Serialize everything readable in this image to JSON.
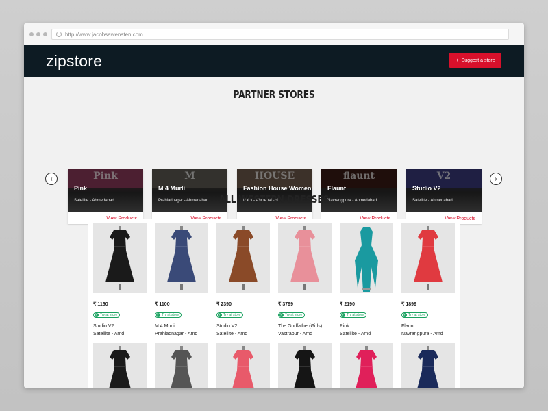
{
  "browser": {
    "url": "http://www.jacobsawensten.com"
  },
  "header": {
    "logo": "zipstore",
    "suggest_label": "Suggest a store",
    "accent": "#d8102b",
    "bg": "#0d1b23"
  },
  "partner_section": {
    "title": "PARTNER STORES"
  },
  "stores": [
    {
      "name": "Pink",
      "location": "Satellite - Ahmedabad",
      "view": "View Products",
      "sign": "Pink",
      "color": "#8a3a5a"
    },
    {
      "name": "M 4 Murli",
      "location": "Prahladnagar - Ahmedabad",
      "view": "View Products",
      "sign": "M",
      "color": "#5e5a52"
    },
    {
      "name": "Fashion House Women",
      "location": "Paldi - Ahmedabad",
      "view": "View Products",
      "sign": "HOUSE",
      "color": "#6e5a4c"
    },
    {
      "name": "Flaunt",
      "location": "Navrangpura - Ahmedabad",
      "view": "View Products",
      "sign": "flaunt",
      "color": "#3a1a14"
    },
    {
      "name": "Studio V2",
      "location": "Satellite - Ahmedabad",
      "view": "View Products",
      "sign": "V2",
      "color": "#3a3a7a"
    }
  ],
  "products_section": {
    "title": "ALL WESTERN DRESSES"
  },
  "try_label": "Try at store",
  "products": [
    {
      "price": "₹ 1160",
      "store": "Studio V2",
      "location": "Satellite - Amd",
      "dress": "#1a1a1a"
    },
    {
      "price": "₹ 1100",
      "store": "M 4 Murli",
      "location": "Prahladnagar - Amd",
      "dress": "#3a4a78"
    },
    {
      "price": "₹ 2390",
      "store": "Studio V2",
      "location": "Satellite - Amd",
      "dress": "#8a4a28"
    },
    {
      "price": "₹ 3799",
      "store": "The Godfather(Girls)",
      "location": "Vastrapur - Amd",
      "dress": "#e8909a"
    },
    {
      "price": "₹ 2190",
      "store": "Pink",
      "location": "Satellite - Amd",
      "dress": "#1a9aa0"
    },
    {
      "price": "₹ 1899",
      "store": "Flaunt",
      "location": "Navrangpura - Amd",
      "dress": "#e03a40"
    }
  ],
  "products_row2": [
    {
      "dress": "#1a1a1a"
    },
    {
      "dress": "#555555"
    },
    {
      "dress": "#e85a6a"
    },
    {
      "dress": "#151515"
    },
    {
      "dress": "#e0205a"
    },
    {
      "dress": "#1a2a5a"
    }
  ]
}
